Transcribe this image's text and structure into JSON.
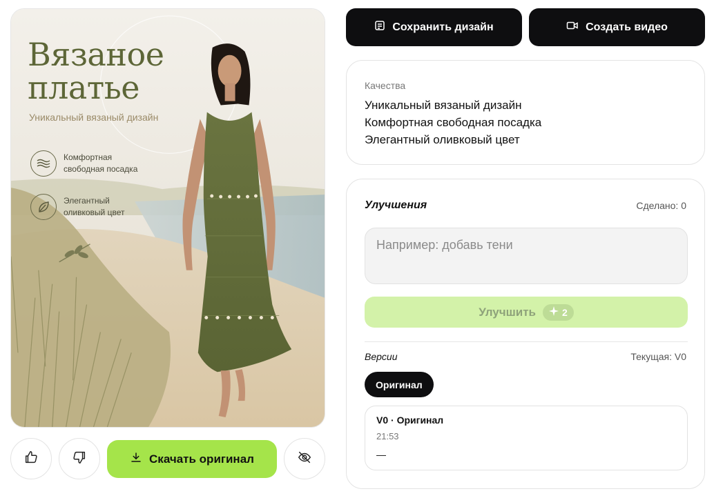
{
  "hero": {
    "title": "Вязаное платье",
    "subtitle": "Уникальный вязаный дизайн",
    "features": [
      {
        "icon": "waves-icon",
        "text": "Комфортная свободная посадка"
      },
      {
        "icon": "leaf-icon",
        "text": "Элегантный оливковый цвет"
      }
    ]
  },
  "actions": {
    "like_icon": "thumbs-up-icon",
    "dislike_icon": "thumbs-down-icon",
    "download_label": "Скачать оригинал",
    "hide_icon": "eye-off-icon"
  },
  "toolbar": {
    "save_label": "Сохранить дизайн",
    "video_label": "Создать видео"
  },
  "qualities": {
    "label": "Качества",
    "items": [
      "Уникальный вязаный дизайн",
      "Комфортная свободная посадка",
      "Элегантный оливковый цвет"
    ]
  },
  "improvements": {
    "title": "Улучшения",
    "done": "Сделано: 0",
    "placeholder": "Например: добавь тени",
    "button_label": "Улучшить",
    "credits": "2"
  },
  "versions": {
    "title": "Версии",
    "current": "Текущая: V0",
    "pill": "Оригинал",
    "items": [
      {
        "name": "V0 · Оригинал",
        "time": "21:53",
        "note": "—"
      }
    ]
  },
  "colors": {
    "accent": "#a5e44a",
    "dark": "#0e0e10",
    "olive": "#5d6637"
  }
}
